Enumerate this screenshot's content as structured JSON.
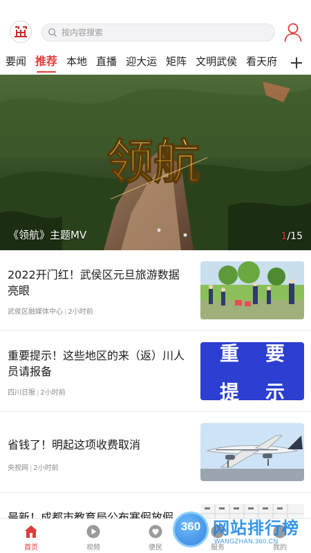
{
  "header": {
    "logo_icon": "app-logo-icon",
    "search_placeholder": "按内容搜索",
    "user_icon": "user-icon"
  },
  "tabs": [
    {
      "label": "要闻",
      "active": false
    },
    {
      "label": "推荐",
      "active": true
    },
    {
      "label": "本地",
      "active": false
    },
    {
      "label": "直播",
      "active": false
    },
    {
      "label": "迎大运",
      "active": false
    },
    {
      "label": "矩阵",
      "active": false
    },
    {
      "label": "文明武侯",
      "active": false
    },
    {
      "label": "看天府",
      "active": false
    }
  ],
  "banner": {
    "caption": "《领航》主题MV",
    "logo_text": "领航",
    "counter_current": "1",
    "counter_total": "/15"
  },
  "news": [
    {
      "title": "2022开门红！武侯区元旦旅游数据亮眼",
      "source": "武侯区融媒体中心",
      "sep": "|",
      "time": "2小时前"
    },
    {
      "title": "重要提示！这些地区的来（返）川人员请报备",
      "source": "四川日报",
      "sep": "|",
      "time": "2小时前",
      "thumb_text": [
        "重",
        "要",
        "提",
        "示"
      ]
    },
    {
      "title": "省钱了！明起这项收费取消",
      "source": "央视网",
      "sep": "|",
      "time": "2小时前"
    },
    {
      "title": "最新！成都市教育局公布寒假放假",
      "source": "",
      "sep": "",
      "time": ""
    }
  ],
  "bottom_nav": [
    {
      "label": "首页",
      "icon": "home-icon",
      "active": true
    },
    {
      "label": "视频",
      "icon": "video-icon",
      "active": false
    },
    {
      "label": "便民",
      "icon": "heart-icon",
      "active": false
    },
    {
      "label": "服务",
      "icon": "service-icon",
      "active": false
    },
    {
      "label": "我的",
      "icon": "profile-icon",
      "active": false
    }
  ],
  "watermark": {
    "number": "360",
    "text": "网站排行榜",
    "sub": "WANGZHAN.360.CN"
  },
  "colors": {
    "accent": "#e23a3a",
    "text": "#1a1a1a",
    "meta": "#8a8a8a"
  }
}
